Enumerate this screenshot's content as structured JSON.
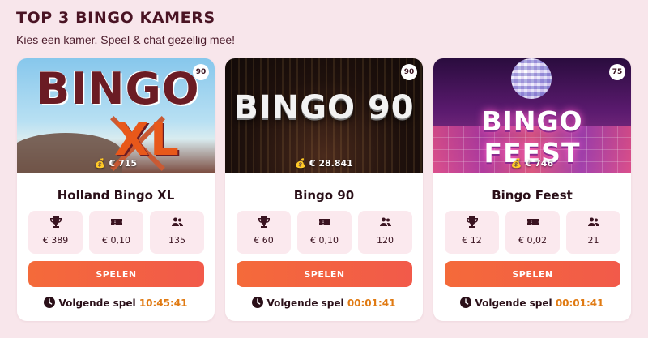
{
  "heading": "TOP 3 BINGO KAMERS",
  "subheading": "Kies een kamer. Speel & chat gezellig mee!",
  "colors": {
    "accent": "#f46a3a",
    "time": "#e07a12",
    "background": "#f8e6eb"
  },
  "icons": {
    "prize": "trophy-icon",
    "ticket": "ticket-icon",
    "players": "users-icon",
    "jackpot": "money-bag-icon",
    "clock": "clock-icon"
  },
  "rooms": [
    {
      "banner_title_a": "BINGO",
      "banner_title_b": "XL",
      "badge": "90",
      "jackpot": "€ 715",
      "name": "Holland Bingo XL",
      "prize": "€ 389",
      "ticket": "€ 0,10",
      "players": "135",
      "button": "SPELEN",
      "next_label": "Volgende spel",
      "next_time": "10:45:41"
    },
    {
      "banner_title_a": "BINGO 90",
      "badge": "90",
      "jackpot": "€ 28.841",
      "name": "Bingo 90",
      "prize": "€ 60",
      "ticket": "€ 0,10",
      "players": "120",
      "button": "SPELEN",
      "next_label": "Volgende spel",
      "next_time": "00:01:41"
    },
    {
      "banner_title_a": "BINGO FEEST",
      "badge": "75",
      "jackpot": "€ 746",
      "name": "Bingo Feest",
      "prize": "€ 12",
      "ticket": "€ 0,02",
      "players": "21",
      "button": "SPELEN",
      "next_label": "Volgende spel",
      "next_time": "00:01:41"
    }
  ]
}
